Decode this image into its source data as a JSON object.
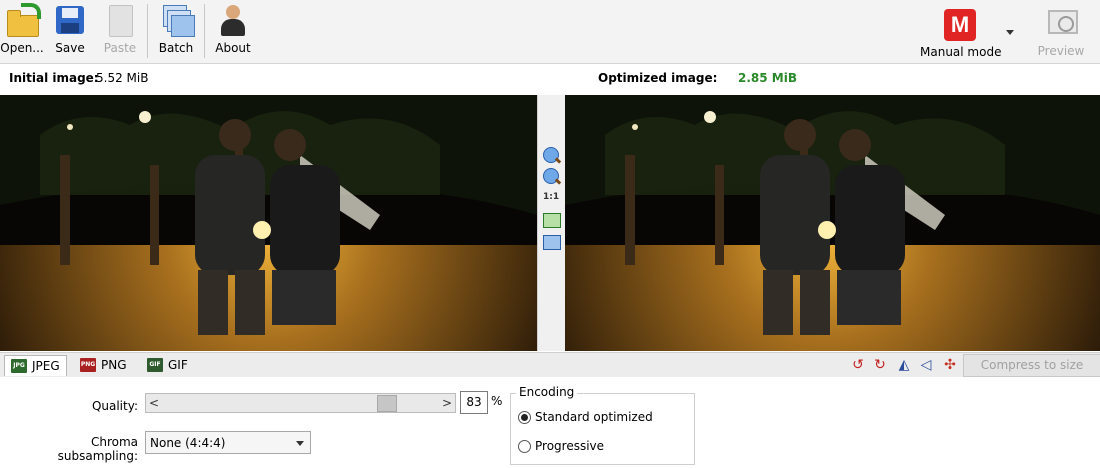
{
  "toolbar": {
    "open_label": "Open...",
    "save_label": "Save",
    "paste_label": "Paste",
    "batch_label": "Batch",
    "about_label": "About",
    "mode_icon_letter": "M",
    "mode_label": "Manual mode",
    "preview_label": "Preview"
  },
  "info": {
    "initial_title": "Initial image:",
    "initial_size": "5.52 MiB",
    "optimized_title": "Optimized image:",
    "optimized_size": "2.85 MiB",
    "optimized_color": "#2a8a2a"
  },
  "viewer": {
    "zoom_label": "1:1"
  },
  "formats": {
    "tabs": [
      {
        "label": "JPEG",
        "icon": "jpeg-file-icon",
        "active": true
      },
      {
        "label": "PNG",
        "icon": "png-file-icon",
        "active": false
      },
      {
        "label": "GIF",
        "icon": "gif-file-icon",
        "active": false
      }
    ],
    "compress_label": "Compress to size"
  },
  "settings": {
    "quality_label": "Quality:",
    "quality_value": "83",
    "quality_unit": "%",
    "slider_level_percent": 83,
    "chroma_label": "Chroma subsampling:",
    "chroma_value": "None (4:4:4)",
    "encoding": {
      "title": "Encoding",
      "options": [
        "Standard optimized",
        "Progressive"
      ],
      "selected": "Standard optimized"
    }
  },
  "colors": {
    "mode_badge": "#e02424",
    "accent_green": "#2a8a2a"
  }
}
